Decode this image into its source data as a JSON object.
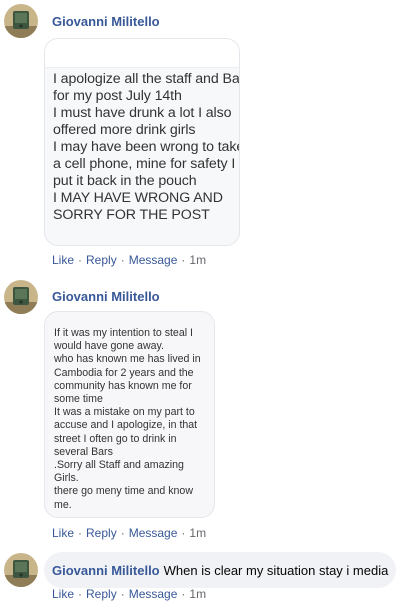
{
  "comments": [
    {
      "author": "Giovanni Militello",
      "image_text": "I apologize all the staff and Ba\nfor my post July 14th\nI must have drunk a lot I also\noffered more drink girls\nI may have been wrong to take\na cell phone, mine for safety I\nput it back in the pouch\nI MAY HAVE WRONG AND\nSORRY FOR THE POST",
      "actions": {
        "like": "Like",
        "reply": "Reply",
        "message": "Message",
        "time": "1m"
      }
    },
    {
      "author": "Giovanni Militello",
      "image_text": "If it was my intention to steal I\nwould have gone away.\nwho has known me has lived in\nCambodia for 2 years and the\ncommunity has known me for\nsome time\nIt was a mistake on my part to\naccuse and I apologize, in that\nstreet I often go to drink in\nseveral Bars\n.Sorry all Staff and amazing\nGirls.\nthere go meny time and know\nme.",
      "actions": {
        "like": "Like",
        "reply": "Reply",
        "message": "Message",
        "time": "1m"
      }
    },
    {
      "author": "Giovanni Militello",
      "text": "When is clear my situation stay i media",
      "actions": {
        "like": "Like",
        "reply": "Reply",
        "message": "Message",
        "time": "1m"
      }
    }
  ],
  "separator": "·"
}
